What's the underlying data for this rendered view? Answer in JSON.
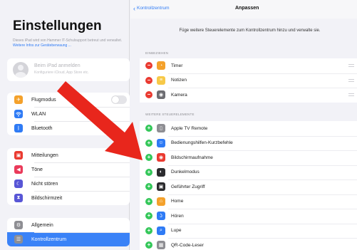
{
  "sidebar": {
    "title": "Einstellungen",
    "description": "Dieses iPad wird von Hammer IT-Schulsupport betreut und verwaltet.",
    "description_link": "Weitere Infos zur Geräteberwaung ...",
    "profile": {
      "name": "Beim iPad anmelden",
      "subtitle": "Konfiguriere iCloud, App Store etc."
    },
    "group1": [
      {
        "label": "Flugmodus",
        "icon": "airplane-icon",
        "color": "#f4a12b"
      },
      {
        "label": "WLAN",
        "icon": "wifi-icon",
        "color": "#2f7bf5"
      },
      {
        "label": "Bluetooth",
        "icon": "bluetooth-icon",
        "color": "#2f7bf5"
      }
    ],
    "group2": [
      {
        "label": "Mitteilungen",
        "icon": "notifications-icon",
        "color": "#ea3a30"
      },
      {
        "label": "Töne",
        "icon": "sound-icon",
        "color": "#ea3a5a"
      },
      {
        "label": "Nicht stören",
        "icon": "moon-icon",
        "color": "#5856d6"
      },
      {
        "label": "Bildschirmzeit",
        "icon": "hourglass-icon",
        "color": "#5856d6"
      }
    ],
    "group3": [
      {
        "label": "Allgemein",
        "icon": "gear-icon",
        "color": "#8e8e93"
      },
      {
        "label": "Kontrollzentrum",
        "icon": "switches-icon",
        "color": "#8e8e93"
      }
    ]
  },
  "navbar": {
    "back_label": "Kontrollzentrum",
    "title": "Anpassen"
  },
  "hint": "Füge weitere Steuerelemente zum Kontrollzentrum hinzu und verwalte sie.",
  "included": {
    "header": "EINBEZIEHEN",
    "items": [
      {
        "label": "Timer",
        "icon": "timer-icon",
        "color": "#f4a12b"
      },
      {
        "label": "Notizen",
        "icon": "notes-icon",
        "color": "#f7c948"
      },
      {
        "label": "Kamera",
        "icon": "camera-icon",
        "color": "#6d6d72"
      }
    ]
  },
  "more": {
    "header": "WEITERE STEUERELEMENTE",
    "items": [
      {
        "label": "Apple TV Remote",
        "icon": "remote-icon",
        "color": "#8e8e93"
      },
      {
        "label": "Bedienungshilfen-Kurzbefehle",
        "icon": "accessibility-icon",
        "color": "#2f7bf5"
      },
      {
        "label": "Bildschirmaufnahme",
        "icon": "record-icon",
        "color": "#ea3a30"
      },
      {
        "label": "Dunkelmodus",
        "icon": "dark-mode-icon",
        "color": "#2b2b2e"
      },
      {
        "label": "Geführter Zugriff",
        "icon": "lock-icon",
        "color": "#2b2b2e"
      },
      {
        "label": "Home",
        "icon": "home-icon",
        "color": "#f4a12b"
      },
      {
        "label": "Hören",
        "icon": "ear-icon",
        "color": "#2f7bf5"
      },
      {
        "label": "Lupe",
        "icon": "magnifier-icon",
        "color": "#2f7bf5"
      },
      {
        "label": "QR-Code-Leser",
        "icon": "qr-code-icon",
        "color": "#8e8e93"
      }
    ]
  },
  "colors": {
    "accent": "#2f7bf5",
    "selected_row": "#3a82f7",
    "remove_badge": "#ea3a30",
    "add_badge": "#34c759",
    "arrow": "#e8261c"
  }
}
